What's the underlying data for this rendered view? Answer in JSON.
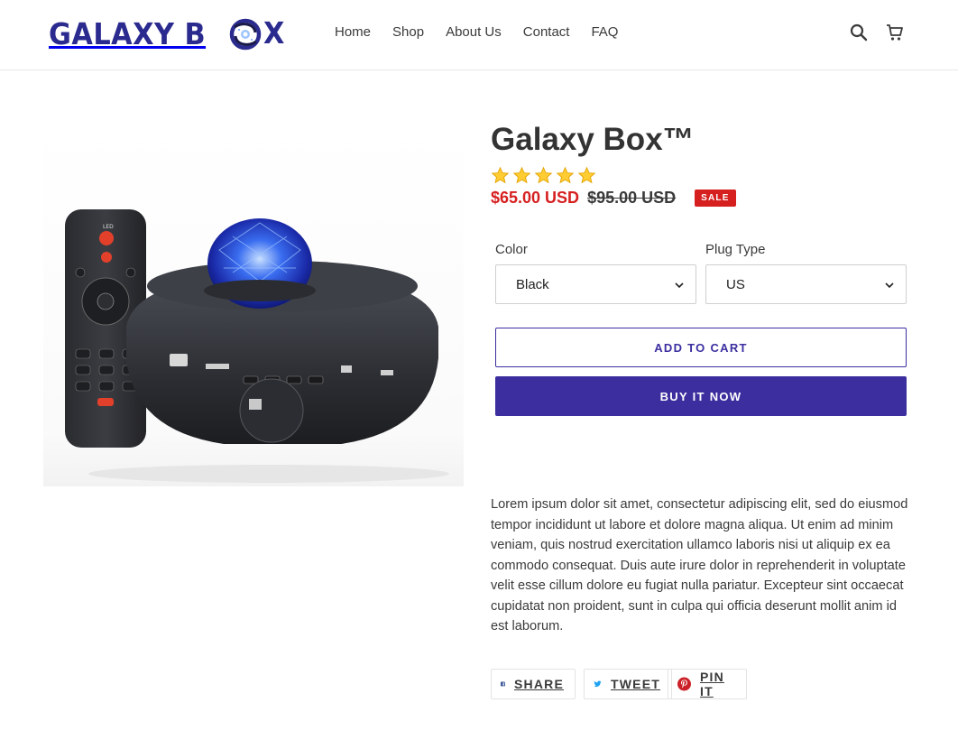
{
  "brand": {
    "logo_text_left": "GALAXY B",
    "logo_text_right": "X",
    "color": "#2b2b8f"
  },
  "nav": {
    "items": [
      {
        "label": "Home"
      },
      {
        "label": "Shop"
      },
      {
        "label": "About Us"
      },
      {
        "label": "Contact"
      },
      {
        "label": "FAQ"
      }
    ],
    "icons": [
      "search-icon",
      "cart-icon"
    ]
  },
  "product": {
    "title": "Galaxy Box™",
    "rating_stars": 5,
    "price_sale": "$65.00 USD",
    "price_compare": "$95.00 USD",
    "sale_badge": "SALE",
    "options": {
      "color_label": "Color",
      "color_value": "Black",
      "plug_label": "Plug Type",
      "plug_value": "US"
    },
    "add_to_cart": "ADD TO CART",
    "buy_now": "BUY IT NOW",
    "description": "Lorem ipsum dolor sit amet, consectetur adipiscing elit, sed do eiusmod tempor incididunt ut labore et dolore magna aliqua. Ut enim ad minim veniam, quis nostrud exercitation ullamco laboris nisi ut aliquip ex ea commodo consequat. Duis aute irure dolor in reprehenderit in voluptate velit esse cillum dolore eu fugiat nulla pariatur. Excepteur sint occaecat cupidatat non proident, sunt in culpa qui officia deserunt mollit anim id est laborum."
  },
  "share": {
    "facebook": "SHARE",
    "twitter": "TWEET",
    "pinterest": "PIN IT"
  },
  "colors": {
    "accent": "#3c2e9e",
    "sale": "#d62020",
    "facebook": "#3b5998",
    "twitter": "#1da1f2",
    "pinterest": "#cb2027"
  }
}
